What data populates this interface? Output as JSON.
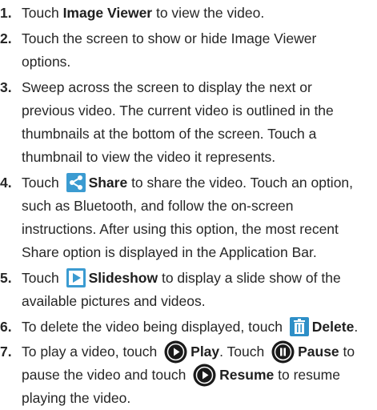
{
  "steps": [
    {
      "num": "1.",
      "a": "Touch ",
      "b": "Image Viewer",
      "c": " to view the video."
    },
    {
      "num": "2.",
      "l1": "Touch the screen to show or hide Image Viewer",
      "l2": "options."
    },
    {
      "num": "3.",
      "l1": "Sweep across the screen to display the next or",
      "l2": "previous video. The current video is outlined in the",
      "l3": "thumbnails at the bottom of the screen. Touch a",
      "l4": "thumbnail to view the video it represents."
    },
    {
      "num": "4.",
      "a": "Touch ",
      "b": "Share",
      "c": " to share the video. Touch an option,",
      "l2": "such as Bluetooth, and follow the on-screen",
      "l3": "instructions. After using this option, the most recent",
      "l4": "Share option is displayed in the Application Bar."
    },
    {
      "num": "5.",
      "a": "Touch ",
      "b": "Slideshow",
      "c": " to display a slide show of the",
      "l2": "available pictures and videos."
    },
    {
      "num": "6.",
      "a": "To delete the video being displayed, touch ",
      "b": "Delete",
      "c": "."
    },
    {
      "num": "7.",
      "a": "To play a video, touch ",
      "b": "Play",
      "c": ". Touch ",
      "d": "Pause",
      "e": " to",
      "l2a": "pause the video and touch ",
      "l2b": "Resume",
      "l2c": " to resume",
      "l3": "playing the video."
    }
  ],
  "icons": {
    "share": "share-icon",
    "slideshow": "slideshow-icon",
    "delete": "trash-icon",
    "play": "play-icon",
    "pause": "pause-icon",
    "resume": "resume-icon"
  },
  "colors": {
    "icon_blue": "#3b9bd1",
    "icon_dark": "#1a1a1a"
  }
}
